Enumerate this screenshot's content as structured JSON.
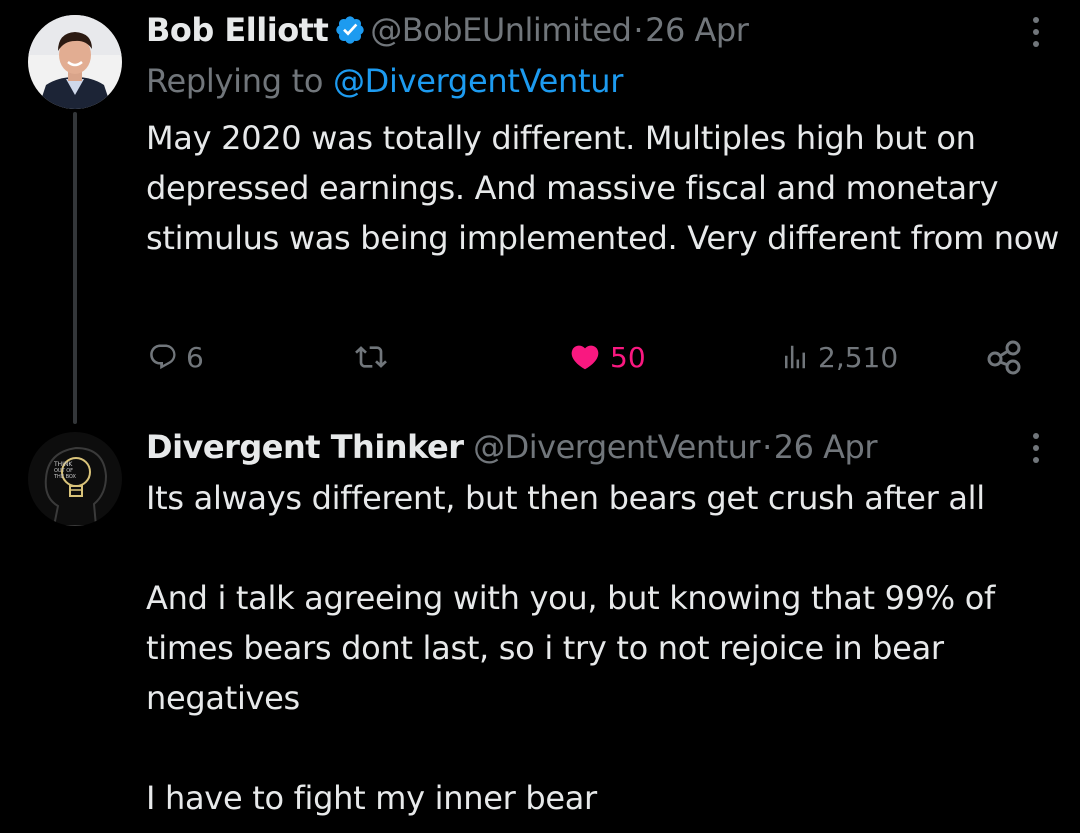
{
  "tweets": [
    {
      "author": {
        "name": "Bob Elliott",
        "handle": "@BobEUnlimited",
        "verified": true
      },
      "separator": "·",
      "date": "26 Apr",
      "replying_label": "Replying to",
      "replying_to": "@DivergentVentur",
      "text": "May 2020 was totally different.  Multiples high but on depressed earnings.  And massive fiscal and monetary stimulus was being implemented.  Very different from now",
      "stats": {
        "replies": "6",
        "likes": "50",
        "views": "2,510"
      },
      "liked": true
    },
    {
      "author": {
        "name": "Divergent Thinker",
        "handle": "@DivergentVentur",
        "avatar_text": "THINK OUT OF THE BOX"
      },
      "separator": "·",
      "date": "26 Apr",
      "paragraphs": [
        "Its always different, but then bears get crush after all",
        "And i talk agreeing with you, but knowing that 99% of times bears dont last, so i try to not rejoice in bear negatives",
        "I have to fight my inner bear"
      ]
    }
  ],
  "colors": {
    "background": "#000000",
    "primary_text": "#e7e9ea",
    "secondary_text": "#71767b",
    "link": "#1d9bf0",
    "like": "#f91880",
    "verified": "#1d9bf0"
  },
  "icons": {
    "reply": "reply-icon",
    "retweet": "retweet-icon",
    "like": "heart-icon",
    "views": "views-icon",
    "share": "share-icon",
    "more": "more-vertical-icon",
    "verified": "verified-badge-icon"
  }
}
